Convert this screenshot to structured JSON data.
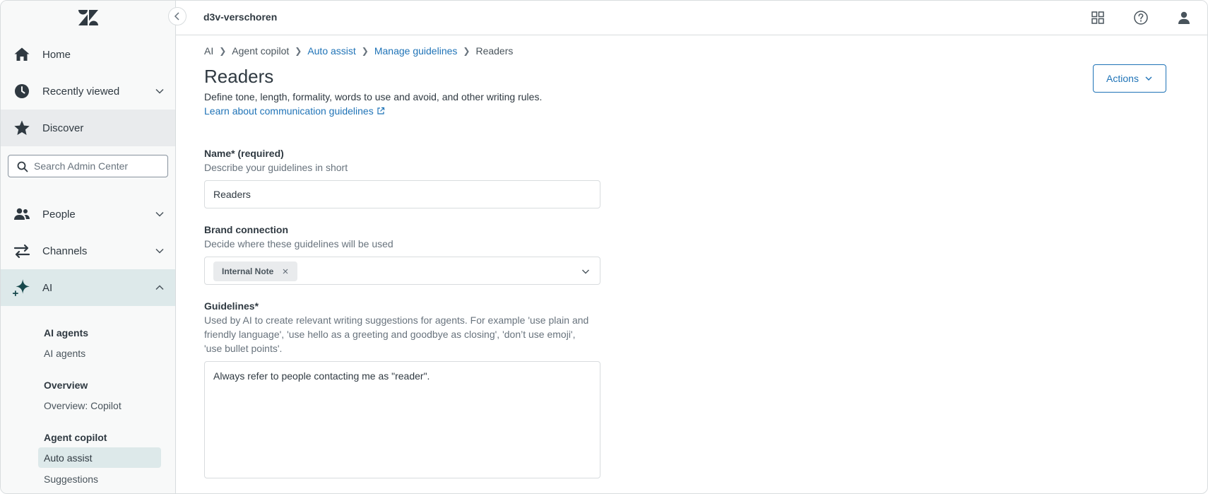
{
  "colors": {
    "accent": "#1f73b7",
    "sidebar_bg": "#f8f9f9",
    "sidebar_active": "#dde9ea",
    "text_primary": "#2f3941",
    "text_secondary": "#68737d"
  },
  "sidebar": {
    "logo_icon": "zendesk-logo",
    "nav": {
      "home": {
        "label": "Home",
        "icon": "home-icon"
      },
      "recent": {
        "label": "Recently viewed",
        "icon": "clock-icon"
      },
      "discover": {
        "label": "Discover",
        "icon": "star-icon"
      },
      "people": {
        "label": "People",
        "icon": "people-icon"
      },
      "channels": {
        "label": "Channels",
        "icon": "arrows-icon"
      },
      "ai": {
        "label": "AI",
        "icon": "sparkle-icon"
      }
    },
    "search": {
      "placeholder": "Search Admin Center"
    },
    "ai_submenu": {
      "group1_title": "AI agents",
      "group1_item": "AI agents",
      "group2_title": "Overview",
      "group2_item": "Overview: Copilot",
      "group3_title": "Agent copilot",
      "group3_item1": "Auto assist",
      "group3_item2": "Suggestions"
    }
  },
  "header": {
    "account": "d3v-verschoren"
  },
  "breadcrumb": {
    "b1": "AI",
    "b2": "Agent copilot",
    "b3": "Auto assist",
    "b4": "Manage guidelines",
    "b5": "Readers"
  },
  "page": {
    "title": "Readers",
    "description": "Define tone, length, formality, words to use and avoid, and other writing rules.",
    "learn_link": "Learn about communication guidelines",
    "actions_label": "Actions"
  },
  "form": {
    "name": {
      "label": "Name* (required)",
      "hint": "Describe your guidelines in short",
      "value": "Readers"
    },
    "brand": {
      "label": "Brand connection",
      "hint": "Decide where these guidelines will be used",
      "tag": "Internal Note"
    },
    "guidelines": {
      "label": "Guidelines*",
      "hint": "Used by AI to create relevant writing suggestions for agents. For example 'use plain and friendly language', 'use hello as a greeting and goodbye as closing', 'don’t use emoji', 'use bullet points'.",
      "value": "Always refer to people contacting me as \"reader\"."
    }
  }
}
